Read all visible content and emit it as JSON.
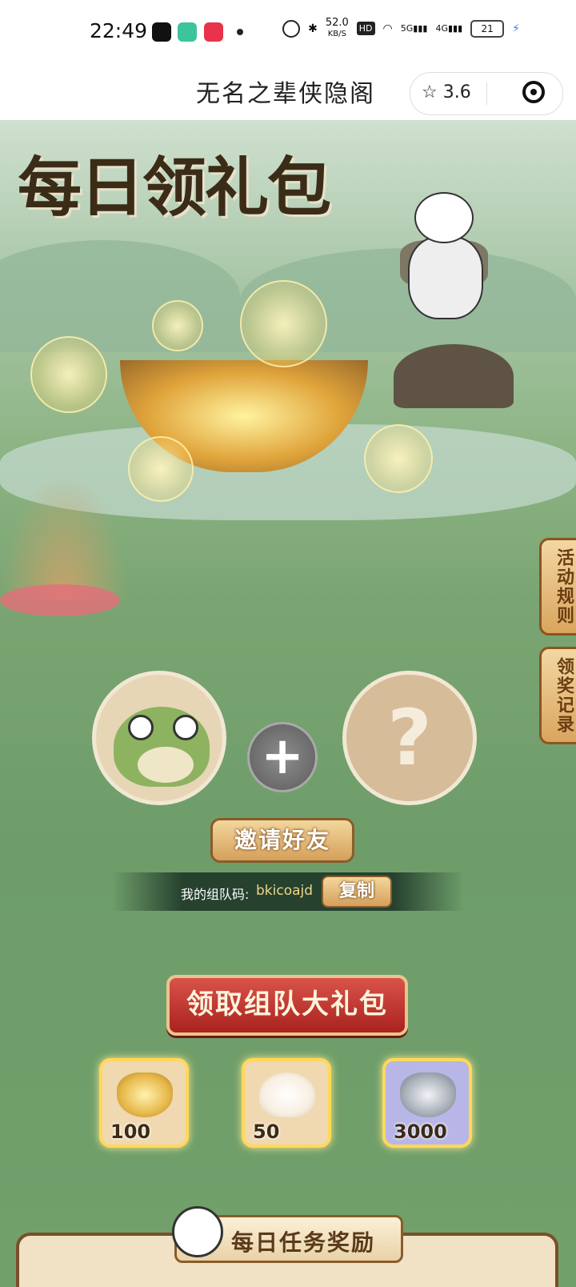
{
  "status_bar": {
    "time": "22:49",
    "net_speed": "52.0",
    "net_unit": "KB/S",
    "hd": "HD",
    "signal_5g": "5G",
    "signal_4g": "4G",
    "battery": "21"
  },
  "app": {
    "title": "无名之辈侠隐阁",
    "rating": "3.6"
  },
  "banner": {
    "headline": "每日领礼包"
  },
  "side_buttons": {
    "rules": "活动规则",
    "records": "领奖记录"
  },
  "team": {
    "unknown_mark": "?",
    "plus": "+",
    "invite_label": "邀请好友",
    "code_label": "我的组队码:",
    "code_value": "bkicoajd",
    "copy_label": "复制",
    "claim_label": "领取组队大礼包"
  },
  "rewards": [
    {
      "icon": "gold-ingot-icon",
      "amount": "100",
      "color": "#e6b84a"
    },
    {
      "icon": "steamed-bun-icon",
      "amount": "50",
      "color": "#f7efe2"
    },
    {
      "icon": "silver-ingot-icon",
      "amount": "3000",
      "color": "#a8aeb8"
    }
  ],
  "daily": {
    "title": "每日任务奖励"
  },
  "colors": {
    "accent_gold": "#d5a05b",
    "claim_red": "#a9221e",
    "reward_border": "#ffd85a"
  }
}
